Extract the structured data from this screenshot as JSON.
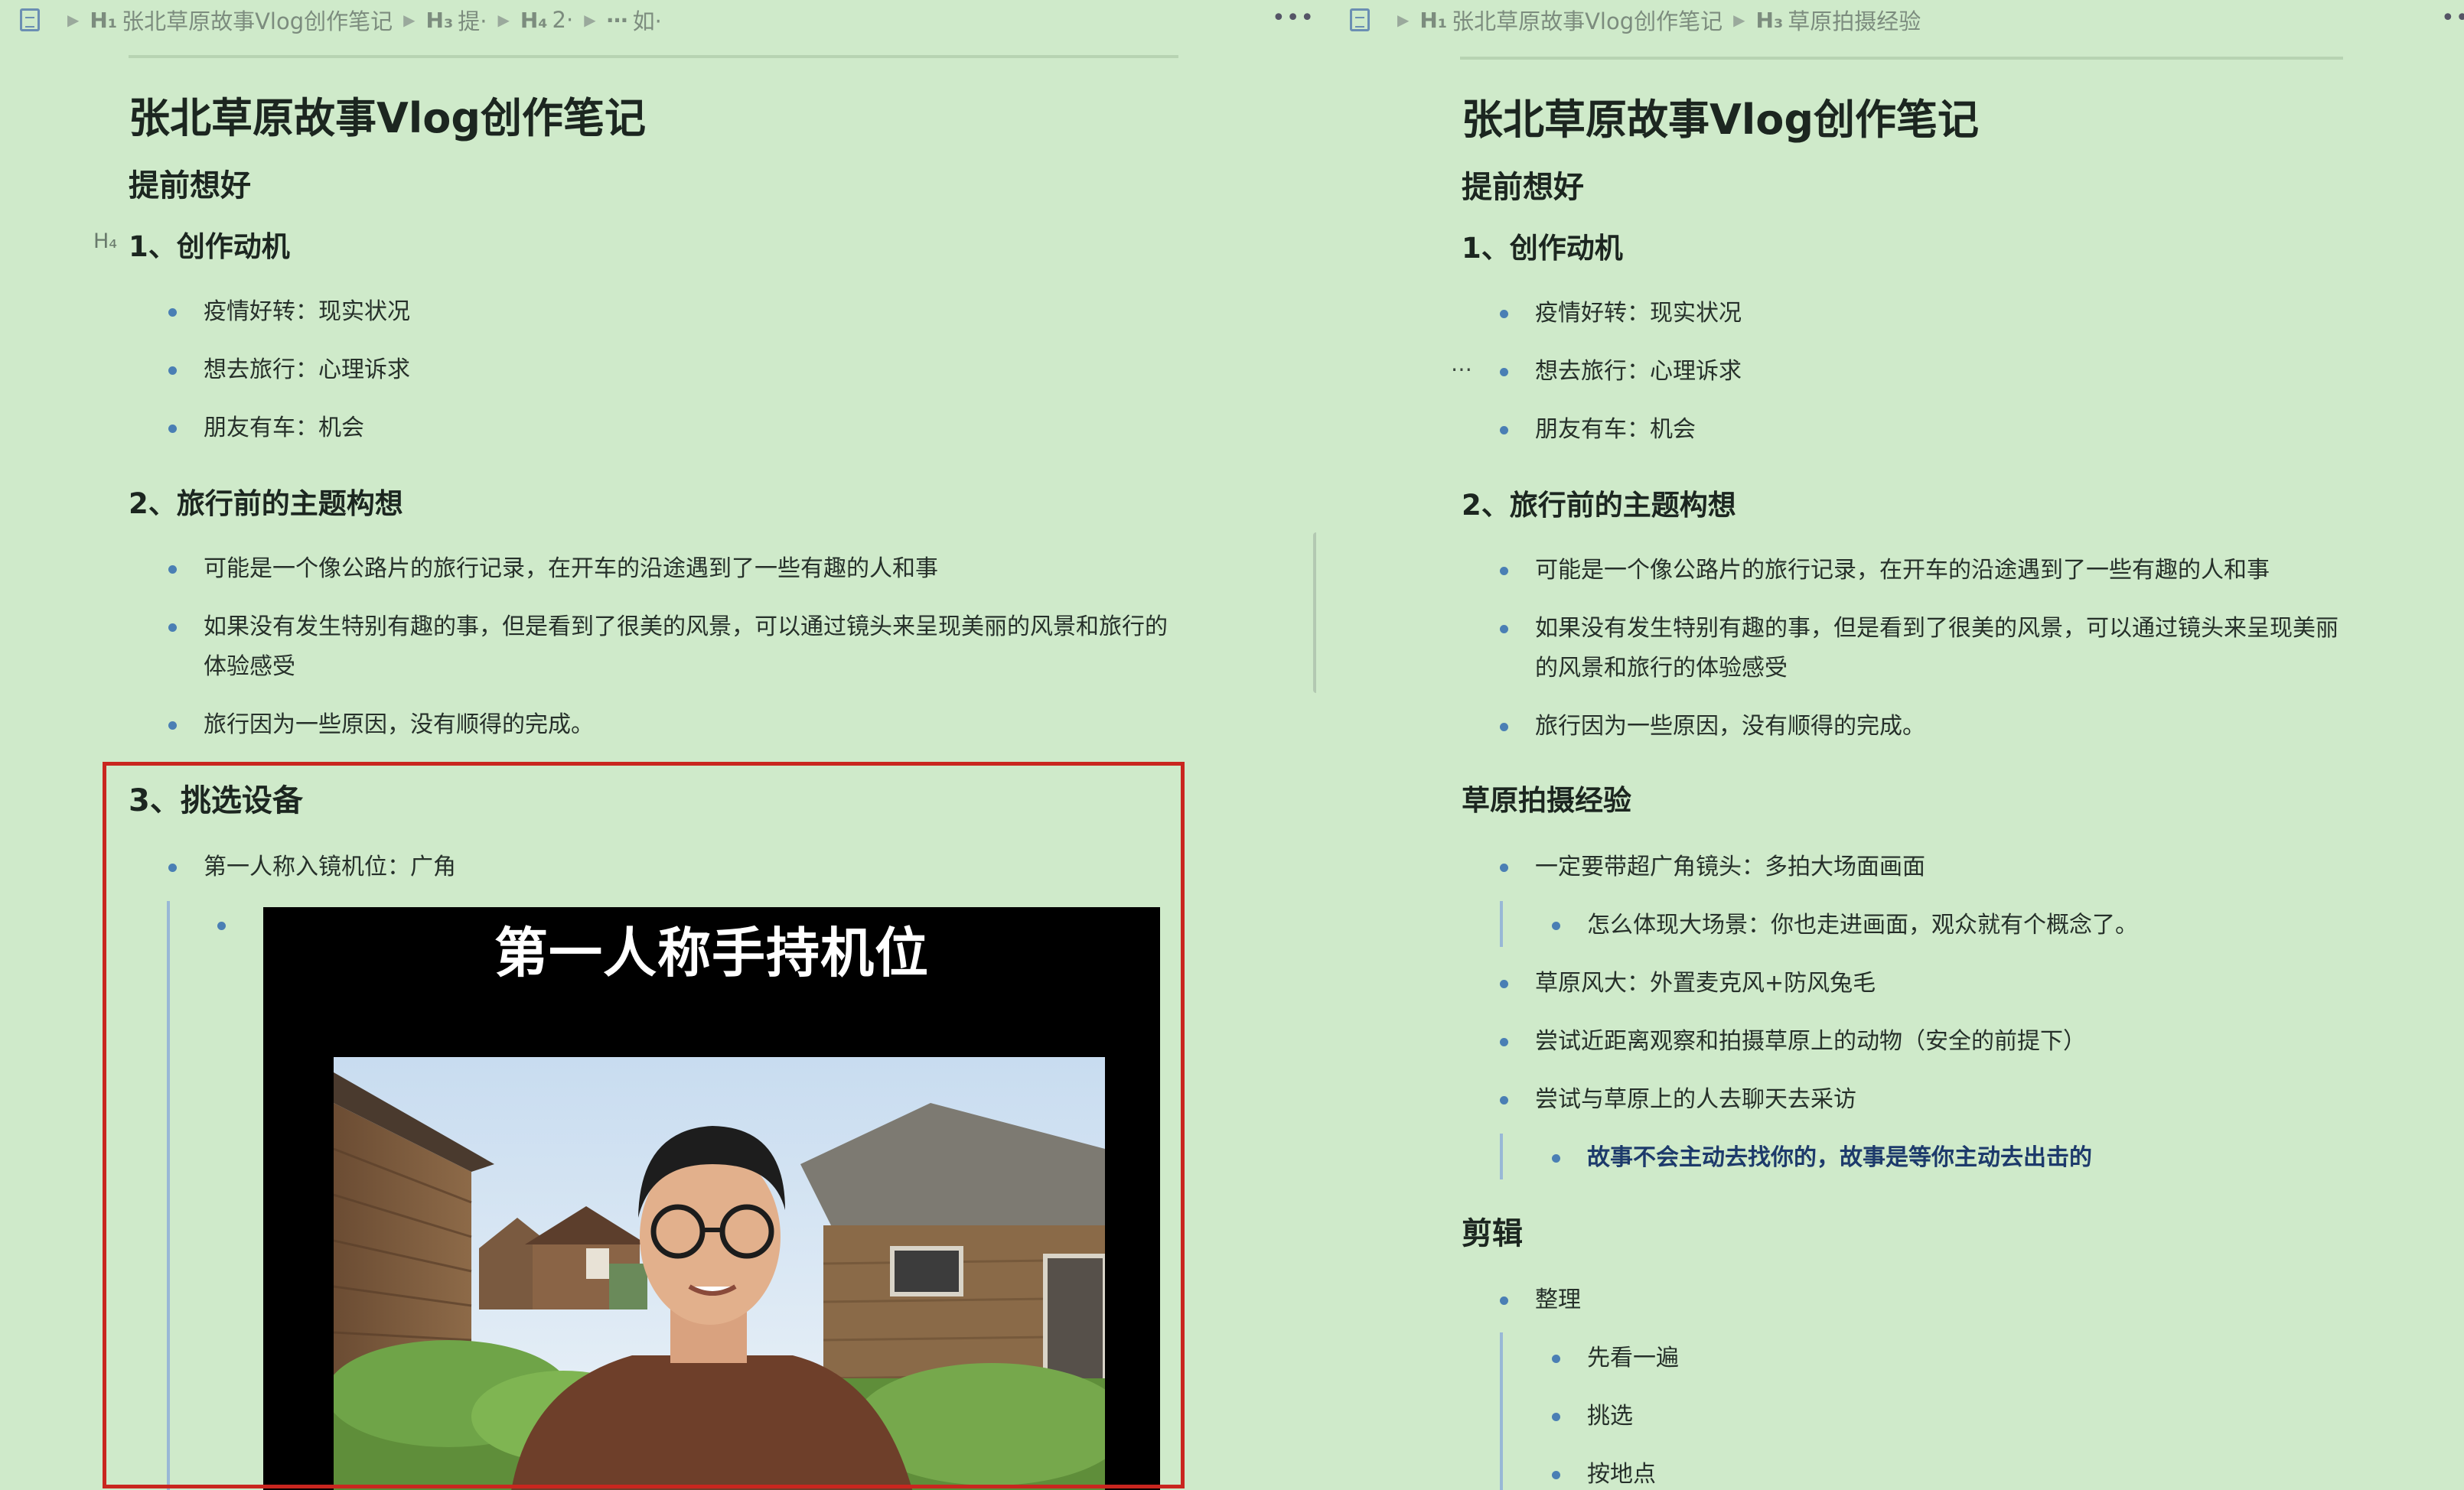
{
  "left_pane": {
    "breadcrumb": {
      "h1_prefix": "H₁",
      "h1_text": "张北草原故事Vlog创作笔记",
      "h3_prefix": "H₃",
      "h3_text": "提·",
      "h4_prefix": "H₄",
      "h4_text": "2·",
      "list_prefix": "⋯",
      "list_text": "如·"
    },
    "more": "•••",
    "title": "张北草原故事Vlog创作笔记",
    "section_heading": "提前想好",
    "h4_marker": "H₄",
    "heading_1": "1、创作动机",
    "list_1": [
      "疫情好转：现实状况",
      "想去旅行：心理诉求",
      "朋友有车：机会"
    ],
    "heading_2": "2、旅行前的主题构想",
    "list_2": [
      "可能是一个像公路片的旅行记录，在开车的沿途遇到了一些有趣的人和事",
      "如果没有发生特别有趣的事，但是看到了很美的风景，可以通过镜头来呈现美丽的风景和旅行的体验感受",
      "旅行因为一些原因，没有顺得的完成。"
    ],
    "heading_3": "3、挑选设备",
    "list_3": [
      "第一人称入镜机位：广角"
    ],
    "media_caption": "第一人称手持机位"
  },
  "right_pane": {
    "breadcrumb": {
      "h1_prefix": "H₁",
      "h1_text": "张北草原故事Vlog创作笔记",
      "h3_prefix": "H₃",
      "h3_text": "草原拍摄经验"
    },
    "more": "•••",
    "title": "张北草原故事Vlog创作笔记",
    "section_heading": "提前想好",
    "heading_1": "1、创作动机",
    "list_1": [
      "疫情好转：现实状况",
      "想去旅行：心理诉求",
      "朋友有车：机会"
    ],
    "heading_2": "2、旅行前的主题构想",
    "list_2": [
      "可能是一个像公路片的旅行记录，在开车的沿途遇到了一些有趣的人和事",
      "如果没有发生特别有趣的事，但是看到了很美的风景，可以通过镜头来呈现美丽的风景和旅行的体验感受",
      "旅行因为一些原因，没有顺得的完成。"
    ],
    "heading_grass": "草原拍摄经验",
    "grass_list": [
      "一定要带超广角镜头：多拍大场面画面",
      "怎么体现大场景：你也走进画面，观众就有个概念了。",
      "草原风大：外置麦克风+防风兔毛",
      "尝试近距离观察和拍摄草原上的动物（安全的前提下）",
      "尝试与草原上的人去聊天去采访",
      "故事不会主动去找你的，故事是等你主动去出击的"
    ],
    "heading_edit": "剪辑",
    "edit_list": [
      "整理",
      "先看一遍",
      "挑选",
      "按地点"
    ]
  },
  "colors": {
    "background": "#cfeaca",
    "bullet": "#4a7fb4",
    "highlight_box": "#c9261f",
    "emphasis_text": "#1d3a6b"
  },
  "icons": [
    "document-icon",
    "chevron-right-icon",
    "more-icon",
    "heading-icon",
    "list-icon"
  ]
}
